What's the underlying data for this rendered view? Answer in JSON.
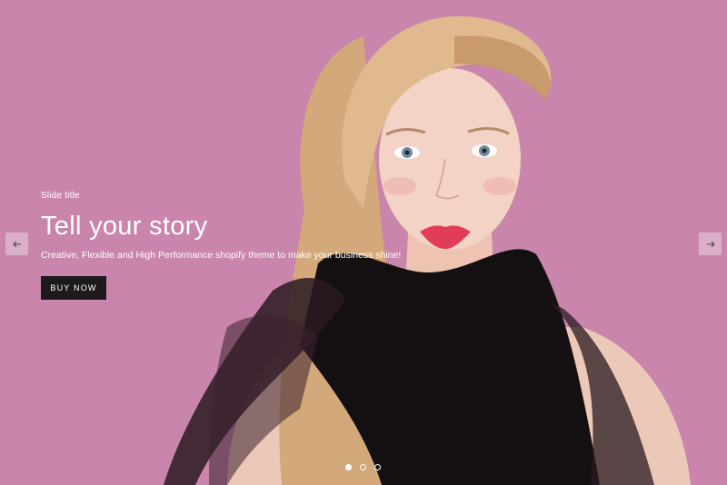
{
  "slide": {
    "subtitle": "Slide title",
    "title": "Tell your story",
    "description": "Creative, Flexible and High Performance shopify theme to make your business shine!",
    "button_label": "BUY NOW"
  },
  "navigation": {
    "prev_icon": "arrow-left-icon",
    "next_icon": "arrow-right-icon"
  },
  "pagination": {
    "total": 3,
    "active_index": 0
  },
  "colors": {
    "background": "#c985ab",
    "button": "#1e1a1c",
    "text": "#ffffff"
  }
}
